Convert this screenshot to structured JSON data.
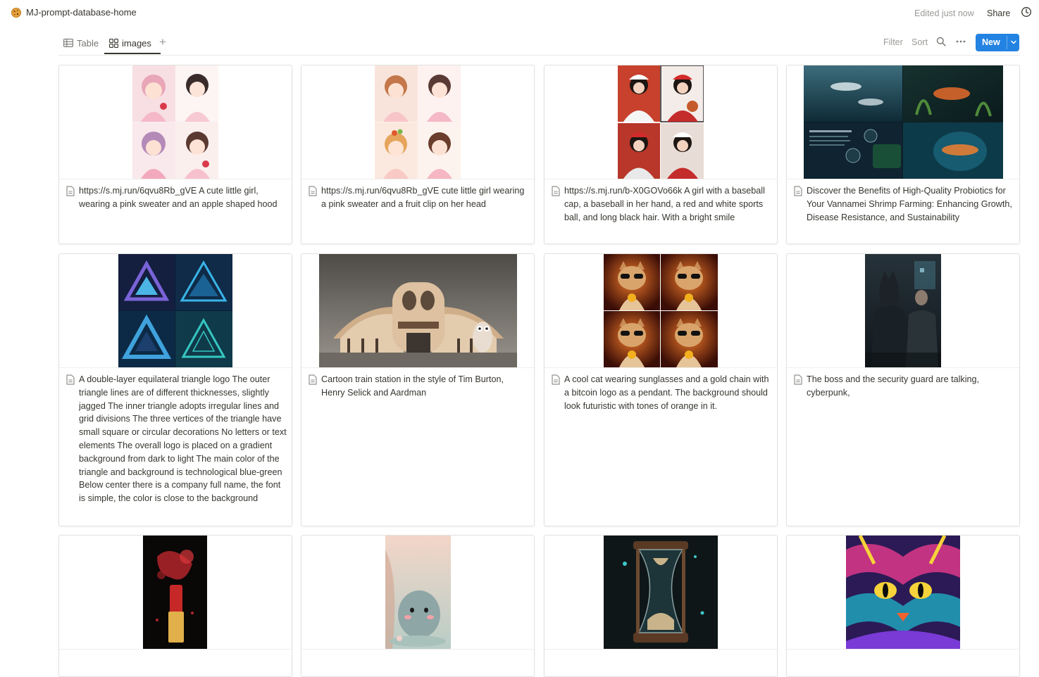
{
  "header": {
    "page_title": "MJ-prompt-database-home",
    "edited_status": "Edited just now",
    "share_label": "Share"
  },
  "views": {
    "tabs": [
      {
        "label": "Table",
        "icon": "table-icon",
        "active": false
      },
      {
        "label": "images",
        "icon": "gallery-icon",
        "active": true
      }
    ],
    "add_view_label": "+",
    "filter_label": "Filter",
    "sort_label": "Sort",
    "new_label": "New"
  },
  "colors": {
    "accent": "#2383e2",
    "text": "#37352f",
    "muted": "#9b9a97",
    "border": "#e3e2e0"
  },
  "cards": [
    {
      "caption": "https://s.mj.run/6qvu8Rb_gVE A cute little girl, wearing a pink sweater and an apple shaped hood"
    },
    {
      "caption": "https://s.mj.run/6qvu8Rb_gVE cute little girl wearing a pink sweater and a fruit clip on her head"
    },
    {
      "caption": "https://s.mj.run/b-X0GOVo66k A girl with a baseball cap, a baseball in her hand, a red and white sports ball, and long black hair. With a bright smile"
    },
    {
      "caption": "Discover the Benefits of High-Quality Probiotics for Your Vannamei Shrimp Farming: Enhancing Growth, Disease Resistance, and Sustainability"
    },
    {
      "caption": "A double-layer equilateral triangle logo The outer triangle lines are of different thicknesses, slightly jagged The inner triangle adopts irregular lines and grid divisions The three vertices of the triangle have small square or circular decorations No letters or text elements The overall logo is placed on a gradient background from dark to light The main color of the triangle and background is technological blue-green Below center there is a company full name, the font is simple, the color is close to the background"
    },
    {
      "caption": "Cartoon train station in the style of Tim Burton, Henry Selick and Aardman"
    },
    {
      "caption": "A cool cat wearing sunglasses and a gold chain with a bitcoin logo as a pendant. The background should look futuristic with tones of orange in it."
    },
    {
      "caption": "The boss and the security guard are talking, cyberpunk,"
    },
    {
      "caption": ""
    },
    {
      "caption": ""
    },
    {
      "caption": ""
    },
    {
      "caption": ""
    }
  ]
}
